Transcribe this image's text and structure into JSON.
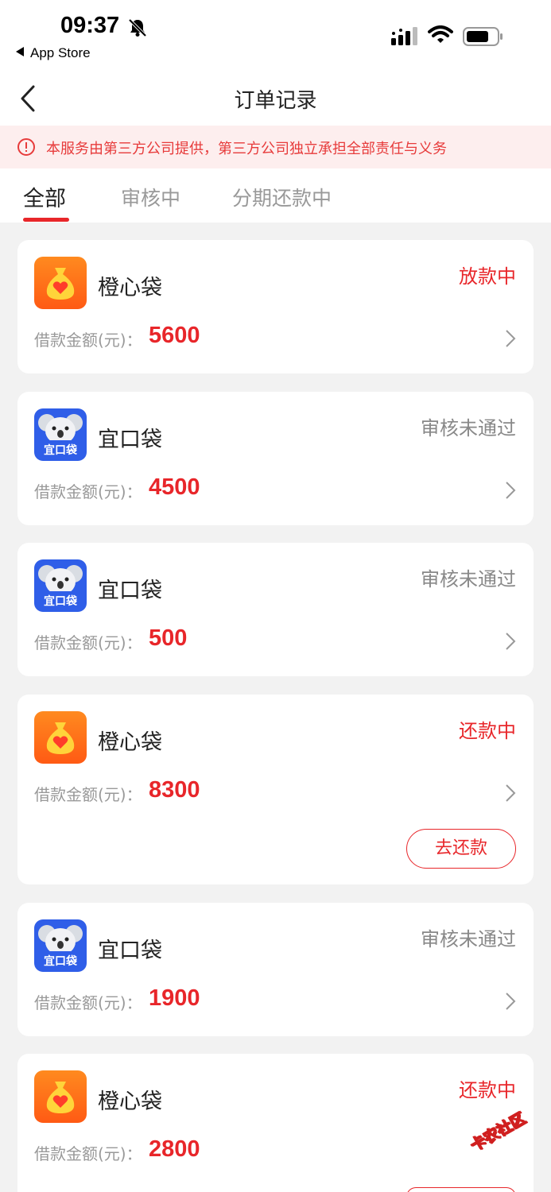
{
  "status_bar": {
    "time": "09:37",
    "back_app": "App Store"
  },
  "nav": {
    "title": "订单记录"
  },
  "notice": {
    "text": "本服务由第三方公司提供，第三方公司独立承担全部责任与义务"
  },
  "tabs": [
    {
      "label": "全部"
    },
    {
      "label": "审核中"
    },
    {
      "label": "分期还款中"
    }
  ],
  "orders": [
    {
      "app": "橙心袋",
      "icon": "orange-money-bag-icon",
      "status": "放款中",
      "amount_label": "借款金额(元)：",
      "amount": "5600"
    },
    {
      "app": "宜口袋",
      "icon": "koala-icon",
      "icon_text": "宜口袋",
      "status": "审核未通过",
      "amount_label": "借款金额(元)：",
      "amount": "4500"
    },
    {
      "app": "宜口袋",
      "icon": "koala-icon",
      "icon_text": "宜口袋",
      "status": "审核未通过",
      "amount_label": "借款金额(元)：",
      "amount": "500"
    },
    {
      "app": "橙心袋",
      "icon": "orange-money-bag-icon",
      "status": "还款中",
      "amount_label": "借款金额(元)：",
      "amount": "8300",
      "action": "去还款"
    },
    {
      "app": "宜口袋",
      "icon": "koala-icon",
      "icon_text": "宜口袋",
      "status": "审核未通过",
      "amount_label": "借款金额(元)：",
      "amount": "1900"
    },
    {
      "app": "橙心袋",
      "icon": "orange-money-bag-icon",
      "status": "还款中",
      "amount_label": "借款金额(元)：",
      "amount": "2800"
    }
  ],
  "watermark": "卡农社区",
  "colors": {
    "accent": "#e8262a",
    "notice_bg": "#fdeeee",
    "page_bg": "#f2f2f2"
  }
}
